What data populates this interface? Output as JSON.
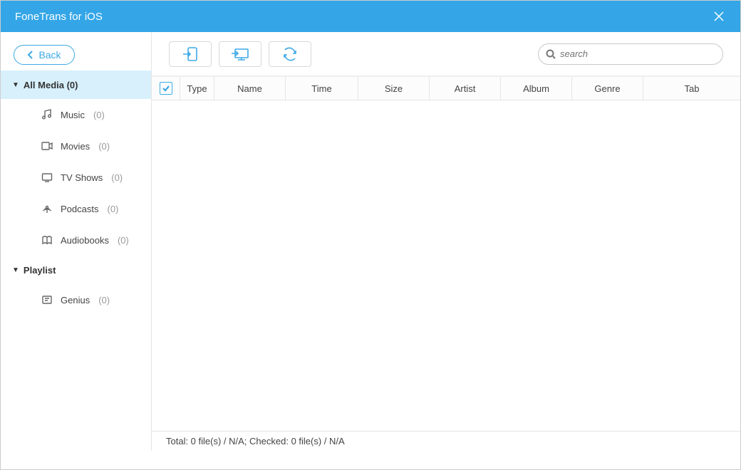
{
  "title": "FoneTrans for iOS",
  "back_label": "Back",
  "search": {
    "placeholder": "search"
  },
  "sidebar": {
    "sections": [
      {
        "label": "All Media (0)",
        "selected": true,
        "items": [
          {
            "label": "Music",
            "count": "(0)",
            "icon": "music"
          },
          {
            "label": "Movies",
            "count": "(0)",
            "icon": "movies"
          },
          {
            "label": "TV Shows",
            "count": "(0)",
            "icon": "tv"
          },
          {
            "label": "Podcasts",
            "count": "(0)",
            "icon": "podcast"
          },
          {
            "label": "Audiobooks",
            "count": "(0)",
            "icon": "audiobook"
          }
        ]
      },
      {
        "label": "Playlist",
        "selected": false,
        "items": [
          {
            "label": "Genius",
            "count": "(0)",
            "icon": "genius"
          }
        ]
      }
    ]
  },
  "table": {
    "columns": [
      "Type",
      "Name",
      "Time",
      "Size",
      "Artist",
      "Album",
      "Genre",
      "Tab"
    ]
  },
  "status": "Total: 0 file(s) / N/A; Checked: 0 file(s) / N/A"
}
